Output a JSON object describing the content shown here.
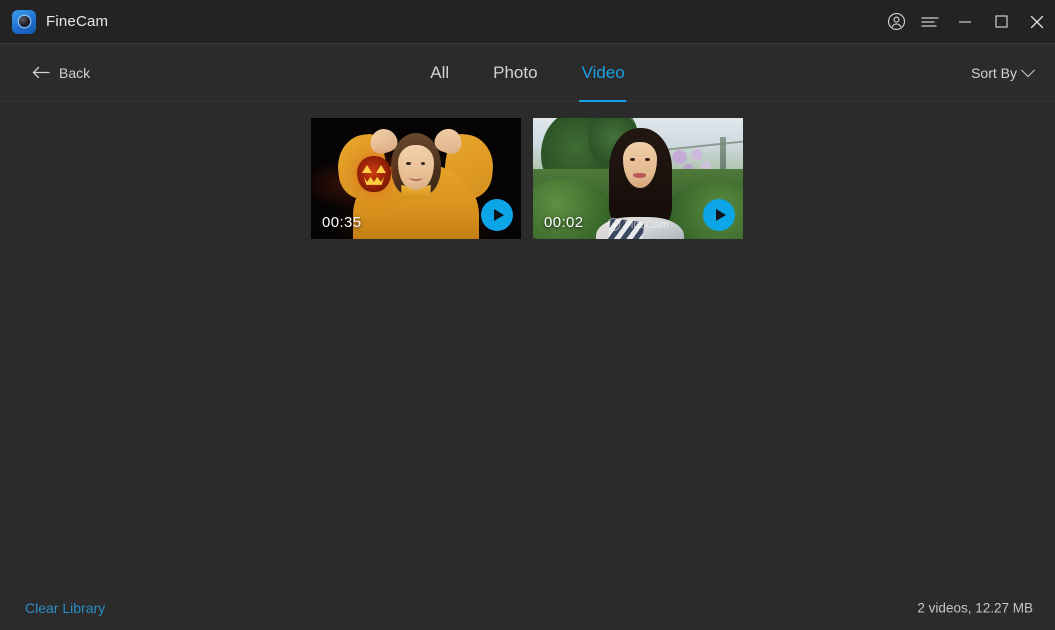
{
  "window": {
    "app_name": "FineCam",
    "logo_icon": "finecam-logo-icon",
    "controls": {
      "account_icon": "account-circle-icon",
      "menu_icon": "hamburger-menu-icon",
      "minimize_icon": "minimize-icon",
      "maximize_icon": "maximize-icon",
      "close_icon": "close-icon"
    }
  },
  "header": {
    "back_label": "Back",
    "back_icon": "arrow-left-icon",
    "tabs": [
      {
        "label": "All",
        "active": false
      },
      {
        "label": "Photo",
        "active": false
      },
      {
        "label": "Video",
        "active": true
      }
    ],
    "sort_by_label": "Sort By",
    "sort_by_icon": "chevron-down-icon",
    "active_tab": "Video",
    "accent_color": "#1aa0e6"
  },
  "library": {
    "items": [
      {
        "duration": "00:35",
        "play_icon": "play-icon",
        "watermark": "",
        "description": "Woman in yellow shirt with hands on head and glowing jack-o-lantern on dark background"
      },
      {
        "duration": "00:02",
        "play_icon": "play-icon",
        "watermark": "FineCam",
        "watermark_icon": "finecam-watermark-icon",
        "description": "Woman smiling outdoors in a garden with green foliage and purple flowers"
      }
    ]
  },
  "footer": {
    "clear_library_label": "Clear Library",
    "library_info": "2 videos, 12.27 MB",
    "link_color": "#2a8fc8"
  }
}
